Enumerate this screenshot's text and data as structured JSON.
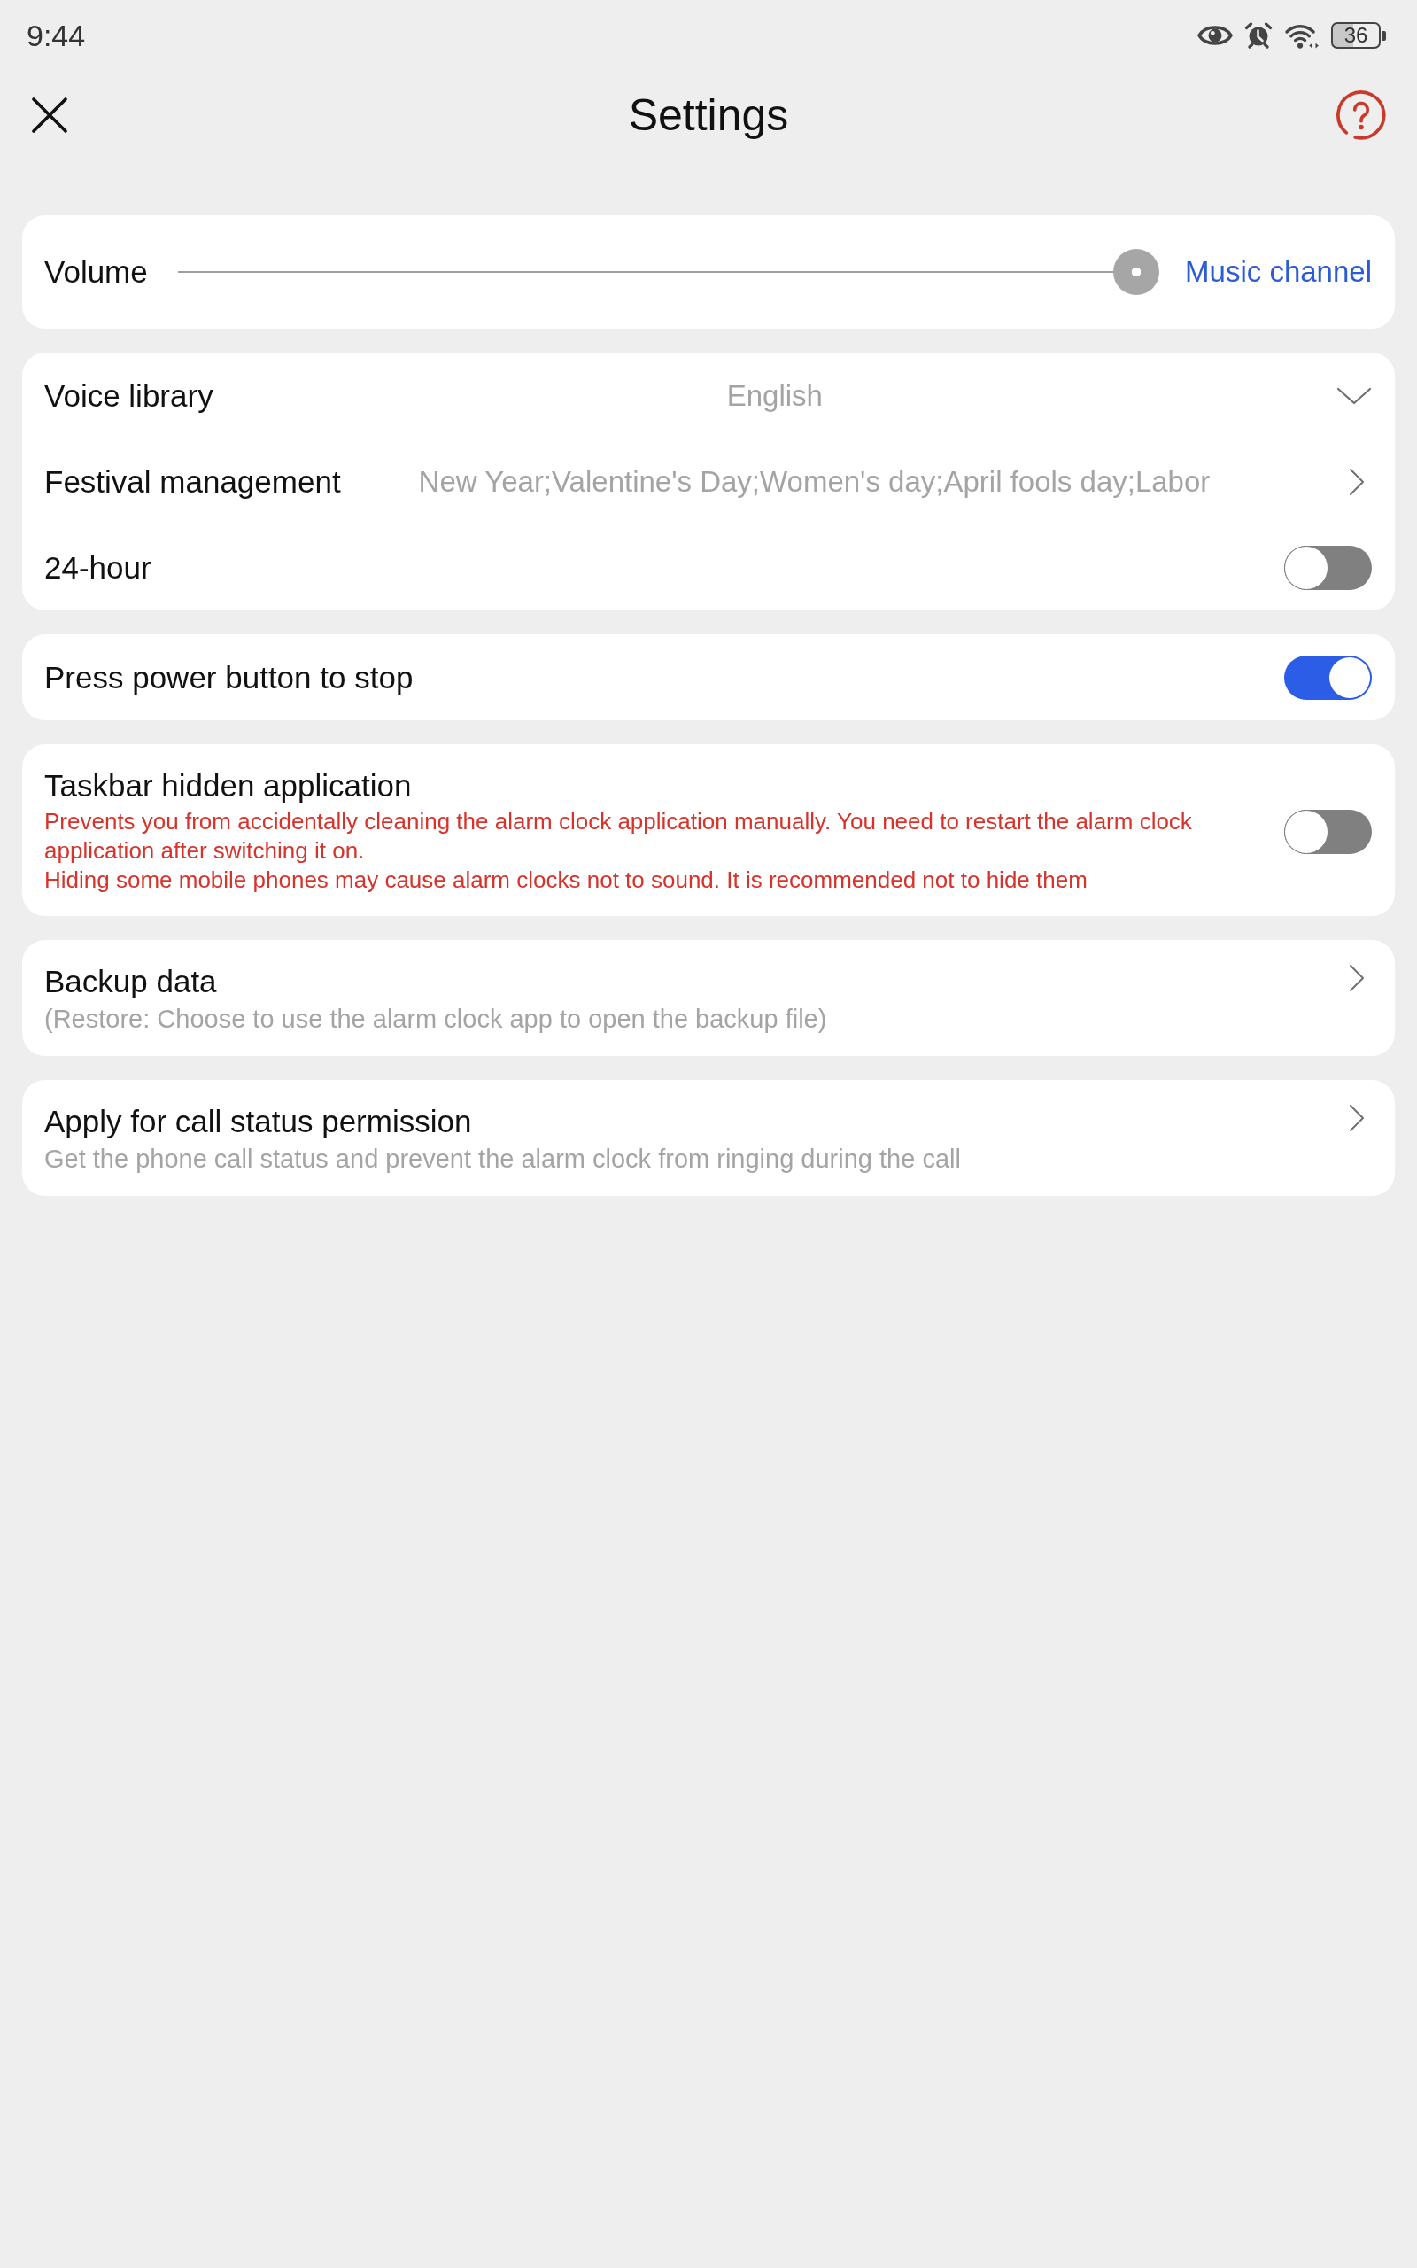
{
  "status_bar": {
    "time": "9:44",
    "battery": "36"
  },
  "header": {
    "title": "Settings"
  },
  "groups": [
    {
      "rows": [
        {
          "kind": "slider",
          "label": "Volume",
          "level": 1,
          "channel": "Music channel"
        }
      ]
    },
    {
      "rows": [
        {
          "kind": "dropdown",
          "label": "Voice library",
          "value": "English"
        },
        {
          "kind": "link",
          "label": "Festival management",
          "value": "New Year;Valentine's Day;Women's day;April fools day;Labor"
        },
        {
          "kind": "toggle",
          "label": "24-hour",
          "on": false
        }
      ]
    },
    {
      "rows": [
        {
          "kind": "toggle",
          "label": "Press power button to stop",
          "on": true
        }
      ]
    },
    {
      "rows": [
        {
          "kind": "toggle",
          "label": "Taskbar hidden application",
          "notes": [
            "Prevents you from accidentally cleaning the alarm clock application manually. You need to restart the alarm clock application after switching it on.",
            "Hiding some mobile phones may cause alarm clocks not to sound. It is recommended not to hide them"
          ],
          "on": false
        }
      ]
    },
    {
      "rows": [
        {
          "kind": "link",
          "label": "Backup data",
          "subtitle": "(Restore: Choose to use the alarm clock app to open the backup file)"
        }
      ]
    },
    {
      "rows": [
        {
          "kind": "link",
          "label": "Apply for call status permission",
          "subtitle": "Get the phone call status and prevent the alarm clock from ringing during the call"
        }
      ]
    }
  ]
}
